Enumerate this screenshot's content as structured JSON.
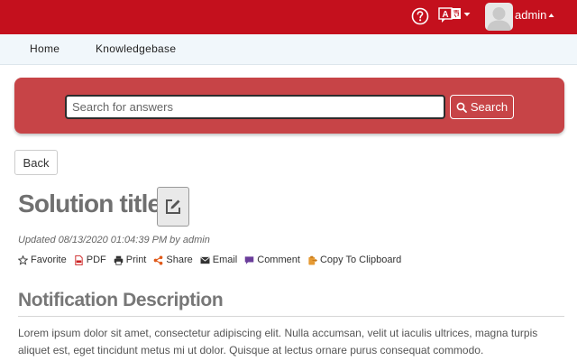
{
  "header": {
    "user_name": "admin",
    "icons": [
      "help-circle-icon",
      "language-translate-icon",
      "user-avatar-icon"
    ]
  },
  "nav": {
    "items": [
      {
        "label": "Home"
      },
      {
        "label": "Knowledgebase"
      }
    ]
  },
  "search": {
    "placeholder": "Search for answers",
    "value": "",
    "button_label": "Search"
  },
  "back_label": "Back",
  "solution": {
    "title": "Solution title",
    "updated": "Updated 08/13/2020 01:04:39 PM by admin",
    "actions": [
      {
        "label": "Favorite",
        "icon": "star-icon"
      },
      {
        "label": "PDF",
        "icon": "pdf-icon"
      },
      {
        "label": "Print",
        "icon": "print-icon"
      },
      {
        "label": "Share",
        "icon": "share-icon"
      },
      {
        "label": "Email",
        "icon": "email-icon"
      },
      {
        "label": "Comment",
        "icon": "comment-icon"
      },
      {
        "label": "Copy To Clipboard",
        "icon": "clipboard-icon"
      }
    ],
    "section_title": "Notification Description",
    "body": "Lorem ipsum dolor sit amet, consectetur adipiscing elit. Nulla accumsan, velit ut iaculis ultrices, magna turpis aliquet est, eget tincidunt metus mi ut dolor. Quisque at lectus ornare purus consequat commodo."
  },
  "colors": {
    "topbar": "#c4101d",
    "search_panel": "#c74447",
    "nav_background": "#f1f7fb",
    "share_icon": "#e05a1a",
    "comment_icon": "#6a3d9a",
    "pdf_icon": "#cc2222",
    "clipboard_icon": "#e69a33"
  }
}
